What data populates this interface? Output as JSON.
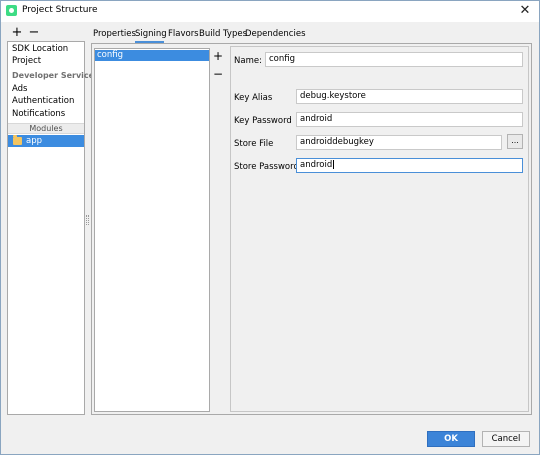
{
  "window": {
    "title": "Project Structure",
    "close_symbol": "✕"
  },
  "sidebar": {
    "add_symbol": "+",
    "remove_symbol": "−",
    "items": [
      {
        "label": "SDK Location"
      },
      {
        "label": "Project"
      }
    ],
    "developer_services_header": "Developer Services",
    "services": [
      {
        "label": "Ads"
      },
      {
        "label": "Authentication"
      },
      {
        "label": "Notifications"
      }
    ],
    "modules_header": "Modules",
    "selected_module": "app"
  },
  "tabs": [
    {
      "label": "Properties"
    },
    {
      "label": "Signing",
      "active": true
    },
    {
      "label": "Flavors"
    },
    {
      "label": "Build Types"
    },
    {
      "label": "Dependencies"
    }
  ],
  "signing": {
    "configs": [
      "config"
    ],
    "add_symbol": "+",
    "remove_symbol": "−",
    "name_label": "Name:",
    "name_value": "config",
    "key_alias_label": "Key Alias",
    "key_alias_value": "debug.keystore",
    "key_password_label": "Key Password",
    "key_password_value": "android",
    "store_file_label": "Store File",
    "store_file_value": "androiddebugkey",
    "browse_label": "...",
    "store_password_label": "Store Password",
    "store_password_value": "android"
  },
  "footer": {
    "ok_label": "OK",
    "cancel_label": "Cancel"
  },
  "colors": {
    "accent": "#3c8ce0",
    "ok_button": "#3c84d8",
    "android_green": "#3ddc84"
  }
}
